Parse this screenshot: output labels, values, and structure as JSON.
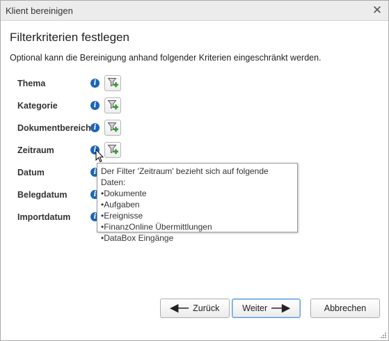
{
  "window": {
    "title": "Klient bereinigen",
    "close_glyph": "✕"
  },
  "main": {
    "heading": "Filterkriterien festlegen",
    "description": "Optional kann die Bereinigung anhand folgender Kriterien eingeschränkt werden."
  },
  "criteria": [
    {
      "label": "Thema",
      "has_filter_button": true
    },
    {
      "label": "Kategorie",
      "has_filter_button": true
    },
    {
      "label": "Dokumentbereich",
      "has_filter_button": true
    },
    {
      "label": "Zeitraum",
      "has_filter_button": true
    },
    {
      "label": "Datum",
      "has_filter_button": false
    },
    {
      "label": "Belegdatum",
      "has_filter_button": false
    },
    {
      "label": "Importdatum",
      "has_filter_button": false
    }
  ],
  "icons": {
    "info": "info-icon",
    "filter_add": "filter-add-icon",
    "info_glyph": "i"
  },
  "tooltip": {
    "header": "Der Filter 'Zeitraum' bezieht sich auf folgende Daten:",
    "items": [
      "Dokumente",
      "Aufgaben",
      "Ereignisse",
      "FinanzOnline Übermittlungen",
      "DataBox Eingänge"
    ]
  },
  "footer": {
    "back_label": "Zurück",
    "next_label": "Weiter",
    "cancel_label": "Abbrechen",
    "back_arrow": "🠸",
    "next_arrow": "🠺"
  },
  "colors": {
    "info_blue": "#1a66b8",
    "filter_green": "#3a9a3a",
    "primary_border": "#5b9bd5"
  }
}
